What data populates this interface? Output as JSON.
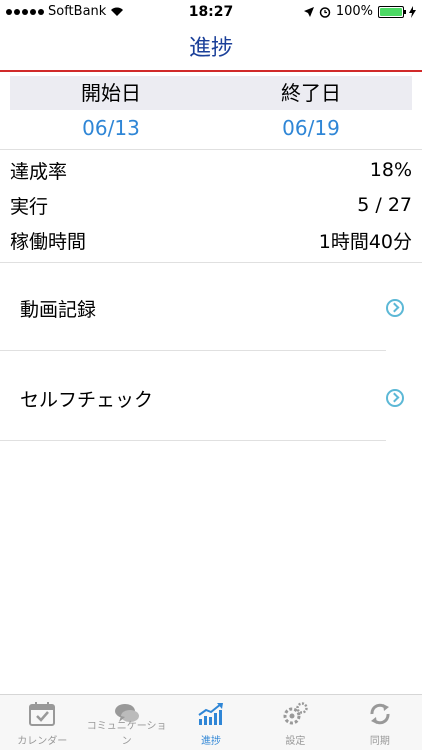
{
  "status_bar": {
    "carrier": "SoftBank",
    "time": "18:27",
    "battery": "100%"
  },
  "nav": {
    "title": "進捗"
  },
  "dates": {
    "start_label": "開始日",
    "start_value": "06/13",
    "end_label": "終了日",
    "end_value": "06/19"
  },
  "stats": [
    {
      "label": "達成率",
      "value": "18%"
    },
    {
      "label": "実行",
      "value": "5 / 27"
    },
    {
      "label": "稼働時間",
      "value": "1時間40分"
    }
  ],
  "menu": [
    {
      "label": "動画記録"
    },
    {
      "label": "セルフチェック"
    }
  ],
  "tabs": [
    {
      "label": "カレンダー",
      "icon": "calendar-icon"
    },
    {
      "label": "コミュニケーション",
      "icon": "chat-icon"
    },
    {
      "label": "進捗",
      "icon": "progress-chart-icon"
    },
    {
      "label": "設定",
      "icon": "gear-icon"
    },
    {
      "label": "同期",
      "icon": "sync-icon"
    }
  ],
  "colors": {
    "accent": "#2f86d6",
    "title": "#1a3f99",
    "nav_underline": "#d12a2a"
  }
}
